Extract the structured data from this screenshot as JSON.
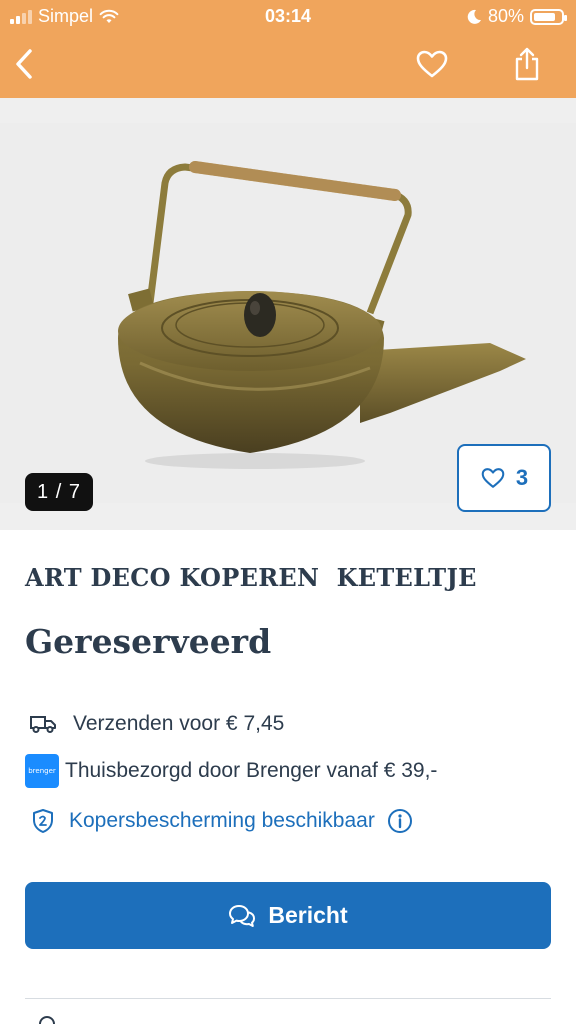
{
  "status_bar": {
    "carrier": "Simpel",
    "time": "03:14",
    "battery": "80%",
    "battery_level": 0.8
  },
  "nav": {
    "back_icon": "chevron-left-icon",
    "favorite_icon": "heart-outline-icon",
    "share_icon": "share-icon"
  },
  "gallery": {
    "counter": "1 / 7",
    "likes": "3"
  },
  "listing": {
    "title": "ART DECO KOPEREN  KETELTJE",
    "status": "Gereserveerd"
  },
  "info": {
    "shipping": "Verzenden voor € 7,45",
    "brenger_logo": "brenger",
    "brenger": "Thuisbezorgd door Brenger vanaf € 39,-",
    "protection": "Kopersbescherming beschikbaar"
  },
  "actions": {
    "message": "Bericht"
  },
  "colors": {
    "header": "#f0a55c",
    "primary": "#1d6fbb",
    "text": "#2d3c4d"
  }
}
